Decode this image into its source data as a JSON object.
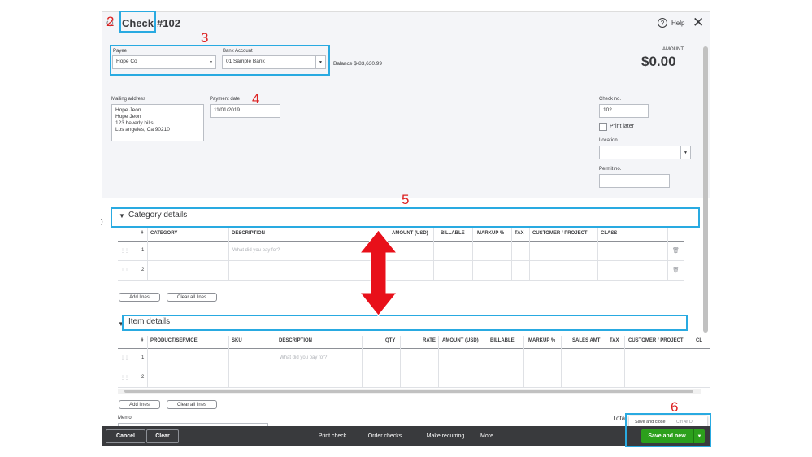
{
  "header": {
    "icon_glyph": "↺",
    "title": "Check",
    "number": "#102",
    "help_label": "Help",
    "amount_label": "AMOUNT",
    "amount_value": "$0.00"
  },
  "form": {
    "payee_label": "Payee",
    "payee_value": "Hope Co",
    "bank_label": "Bank Account",
    "bank_value": "01 Sample Bank",
    "balance": "Balance $-83,630.99",
    "mailing_label": "Mailing address",
    "mailing_lines": [
      "Hope Jeon",
      "Hope Jeon",
      "123 beverly hills",
      "Los angeles, Ca  90210"
    ],
    "payment_date_label": "Payment date",
    "payment_date_value": "11/01/2019",
    "check_no_label": "Check no.",
    "check_no_value": "102",
    "print_later_label": "Print later",
    "location_label": "Location",
    "permit_label": "Permit no."
  },
  "annotations": {
    "n3": "3",
    "n4": "4",
    "n5": "5",
    "n6": "6",
    "n2": "2"
  },
  "category": {
    "title": "Category details",
    "columns": [
      "#",
      "CATEGORY",
      "DESCRIPTION",
      "AMOUNT (USD)",
      "BILLABLE",
      "MARKUP %",
      "TAX",
      "CUSTOMER / PROJECT",
      "CLASS"
    ],
    "rows": [
      {
        "num": "1",
        "desc_placeholder": "What did you pay for?"
      },
      {
        "num": "2",
        "desc_placeholder": ""
      }
    ],
    "add_lines": "Add lines",
    "clear_lines": "Clear all lines"
  },
  "item": {
    "title": "Item details",
    "columns": [
      "#",
      "PRODUCT/SERVICE",
      "SKU",
      "DESCRIPTION",
      "QTY",
      "RATE",
      "AMOUNT (USD)",
      "BILLABLE",
      "MARKUP %",
      "SALES AMT",
      "TAX",
      "CUSTOMER / PROJECT",
      "CL"
    ],
    "rows": [
      {
        "num": "1",
        "desc_placeholder": "What did you pay for?"
      },
      {
        "num": "2",
        "desc_placeholder": ""
      }
    ],
    "add_lines": "Add lines",
    "clear_lines": "Clear all lines"
  },
  "bottom": {
    "memo_label": "Memo",
    "total_label": "Total"
  },
  "footer": {
    "cancel": "Cancel",
    "clear": "Clear",
    "print_check": "Print check",
    "order_checks": "Order checks",
    "make_recurring": "Make recurring",
    "more": "More",
    "save_close": "Save and close",
    "save_close_shortcut": "Ctrl Alt D",
    "save_new": "Save and new"
  },
  "colors": {
    "annotation": "#29aae1",
    "arrow": "#e8101a",
    "save_green": "#2ca01c",
    "footer_bg": "#393a3d"
  }
}
